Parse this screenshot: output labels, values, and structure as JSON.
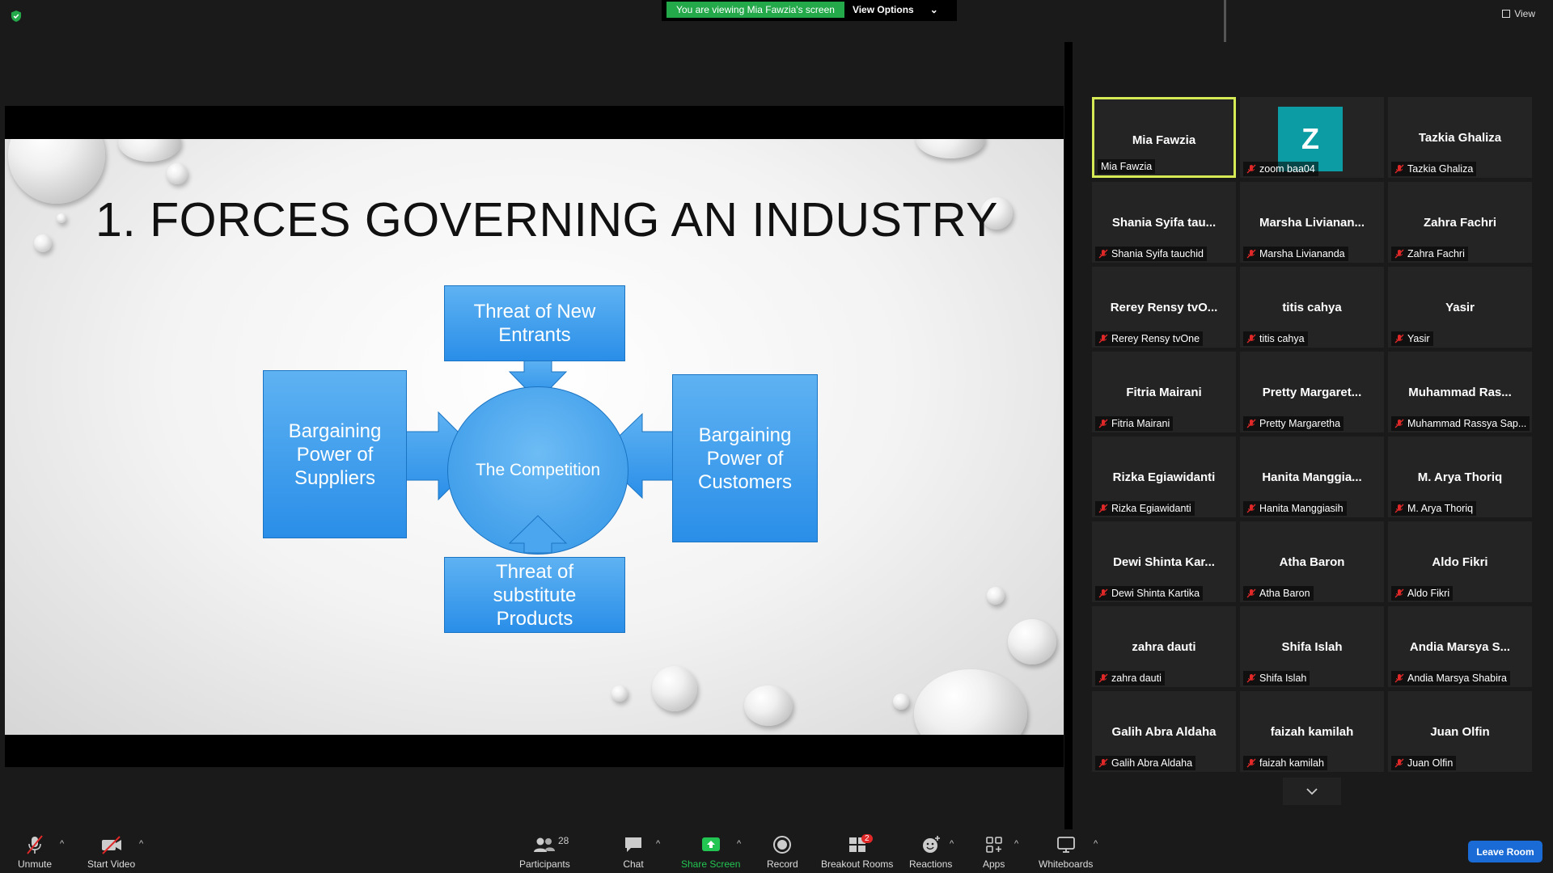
{
  "banner": {
    "viewing_text": "You are viewing Mia Fawzia's screen",
    "view_options_label": "View Options"
  },
  "view_label": "View",
  "slide": {
    "title": "1. FORCES GOVERNING AN INDUSTRY",
    "center": "The Competition",
    "top": "Threat of New Entrants",
    "left": "Bargaining Power of Suppliers",
    "right": "Bargaining Power of Customers",
    "bottom": "Threat of substitute Products"
  },
  "participants_tiles": [
    {
      "name": "Mia Fawzia",
      "label": "Mia Fawzia",
      "active": true,
      "muted": false
    },
    {
      "name": "",
      "label": "zoom baa04",
      "avatar": "Z",
      "muted": true
    },
    {
      "name": "Tazkia Ghaliza",
      "label": "Tazkia Ghaliza",
      "muted": true
    },
    {
      "name": "Shania Syifa tau...",
      "label": "Shania Syifa tauchid",
      "muted": true
    },
    {
      "name": "Marsha Livianan...",
      "label": "Marsha Liviananda",
      "muted": true
    },
    {
      "name": "Zahra Fachri",
      "label": "Zahra Fachri",
      "muted": true
    },
    {
      "name": "Rerey Rensy tvO...",
      "label": "Rerey Rensy tvOne",
      "muted": true
    },
    {
      "name": "titis cahya",
      "label": "titis cahya",
      "muted": true
    },
    {
      "name": "Yasir",
      "label": "Yasir",
      "muted": true
    },
    {
      "name": "Fitria Mairani",
      "label": "Fitria Mairani",
      "muted": true
    },
    {
      "name": "Pretty Margaret...",
      "label": "Pretty Margaretha",
      "muted": true
    },
    {
      "name": "Muhammad Ras...",
      "label": "Muhammad Rassya Sap...",
      "muted": true
    },
    {
      "name": "Rizka Egiawidanti",
      "label": "Rizka Egiawidanti",
      "muted": true
    },
    {
      "name": "Hanita Manggia...",
      "label": "Hanita Manggiasih",
      "muted": true
    },
    {
      "name": "M. Arya Thoriq",
      "label": "M. Arya Thoriq",
      "muted": true
    },
    {
      "name": "Dewi Shinta Kar...",
      "label": "Dewi Shinta Kartika",
      "muted": true
    },
    {
      "name": "Atha Baron",
      "label": "Atha Baron",
      "muted": true
    },
    {
      "name": "Aldo Fikri",
      "label": "Aldo Fikri",
      "muted": true
    },
    {
      "name": "zahra dauti",
      "label": "zahra dauti",
      "muted": true
    },
    {
      "name": "Shifa Islah",
      "label": "Shifa Islah",
      "muted": true
    },
    {
      "name": "Andia Marsya S...",
      "label": "Andia Marsya Shabira",
      "muted": true
    },
    {
      "name": "Galih Abra Aldaha",
      "label": "Galih Abra Aldaha",
      "muted": true
    },
    {
      "name": "faizah kamilah",
      "label": "faizah kamilah",
      "muted": true
    },
    {
      "name": "Juan Olfin",
      "label": "Juan Olfin",
      "muted": true
    }
  ],
  "toolbar": {
    "unmute": "Unmute",
    "start_video": "Start Video",
    "participants": "Participants",
    "participants_count": "28",
    "chat": "Chat",
    "share_screen": "Share Screen",
    "record": "Record",
    "breakout_rooms": "Breakout Rooms",
    "breakout_badge": "2",
    "reactions": "Reactions",
    "apps": "Apps",
    "whiteboards": "Whiteboards",
    "leave_room": "Leave Room"
  },
  "colors": {
    "share_green": "#23a94a",
    "active_border": "#d6ea55",
    "leave_blue": "#1a6bd6",
    "avatar_teal": "#0c9ca3",
    "slide_blue": "#3294e6"
  }
}
